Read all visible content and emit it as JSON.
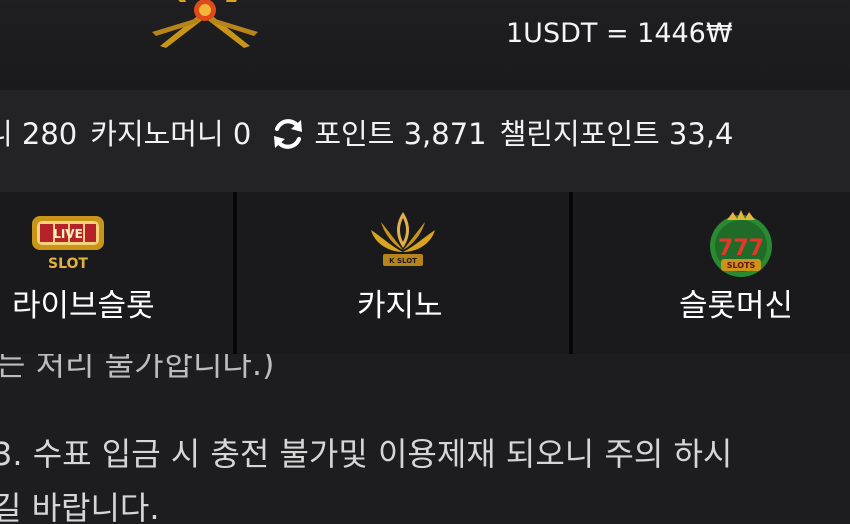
{
  "header": {
    "logo": "site-logo",
    "exchange_rate": "1USDT = 1446₩"
  },
  "balance": {
    "item1_label": "니 280",
    "item2_label": "카지노머니 0",
    "refresh_icon": "refresh-icon",
    "points_label": "포인트 3,871",
    "challenge_label": "챌린지포인트 33,4"
  },
  "tabs": {
    "live_slot": {
      "label": "라이브슬롯",
      "thumb_text_top": "LIVE",
      "thumb_text_bottom": "SLOT"
    },
    "casino": {
      "label": "카지노",
      "thumb_text": "K SLOT"
    },
    "slot_machine": {
      "label": "슬롯머신",
      "thumb_text_top": "777",
      "thumb_text_bottom": "SLOTS"
    }
  },
  "notice": {
    "line_partial": "는 처리 불가합니다.)",
    "line3": "3. 수표 입금 시 충전 불가및 이용제재 되오니 주의 하시",
    "line3b": "길 바랍니다."
  },
  "colors": {
    "background": "#1c1c1e",
    "gold": "#d9a520",
    "text": "#ffffff"
  }
}
